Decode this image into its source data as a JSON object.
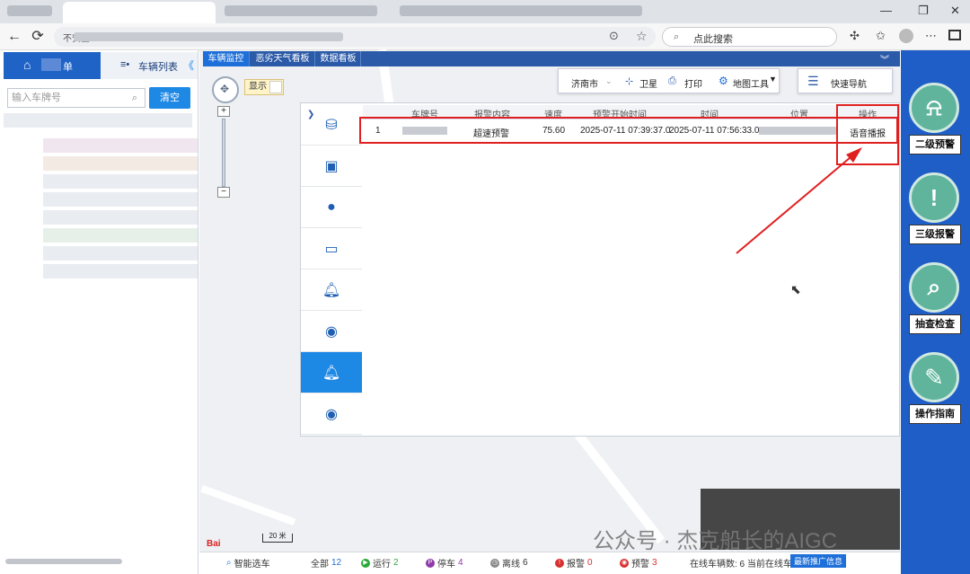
{
  "browser": {
    "search_placeholder": "点此搜索",
    "address_prefix": "不安全"
  },
  "left": {
    "tab_list": "单",
    "tab_vehicles": "车辆列表",
    "collapse": "《",
    "search_placeholder": "输入车牌号",
    "clear_label": "清空"
  },
  "main": {
    "tabs": [
      "车辆监控",
      "恶劣天气看板",
      "数据看板"
    ],
    "show_label": "显示",
    "toolbar": {
      "city": "济南市",
      "satellite": "卫星",
      "print": "打印",
      "map_tools": "地图工具",
      "quick_nav": "快速导航"
    },
    "scale": "20 米"
  },
  "alarm_table": {
    "headers": [
      "车牌号",
      "报警内容",
      "速度",
      "预警开始时间",
      "时间",
      "位置",
      "操作"
    ],
    "rows": [
      {
        "index": "1",
        "plate": "",
        "content": "超速预警",
        "speed": "75.60",
        "start_time": "2025-07-11 07:39:37.0",
        "time": "2025-07-11 07:56:33.0",
        "location": "",
        "action": "语音播报"
      }
    ]
  },
  "right": {
    "buttons": [
      {
        "label": "二级预警",
        "icon": "siren-icon"
      },
      {
        "label": "三级报警",
        "icon": "warning-icon"
      },
      {
        "label": "抽查检查",
        "icon": "shield-search-icon"
      },
      {
        "label": "操作指南",
        "icon": "guide-doc-icon"
      }
    ]
  },
  "status": {
    "smart_select": "智能选车",
    "all_label": "全部",
    "all": "12",
    "running_label": "运行",
    "running": "2",
    "parked_label": "停车",
    "parked": "4",
    "offline_label": "离线",
    "offline": "6",
    "alarm_label": "报警",
    "alarm": "0",
    "warning_label": "预警",
    "warning": "3",
    "online_prefix": "在线车辆数: 6 当前在线车",
    "refresh": "最新推广信息"
  },
  "watermark": "公众号 · 杰克船长的AIGC"
}
